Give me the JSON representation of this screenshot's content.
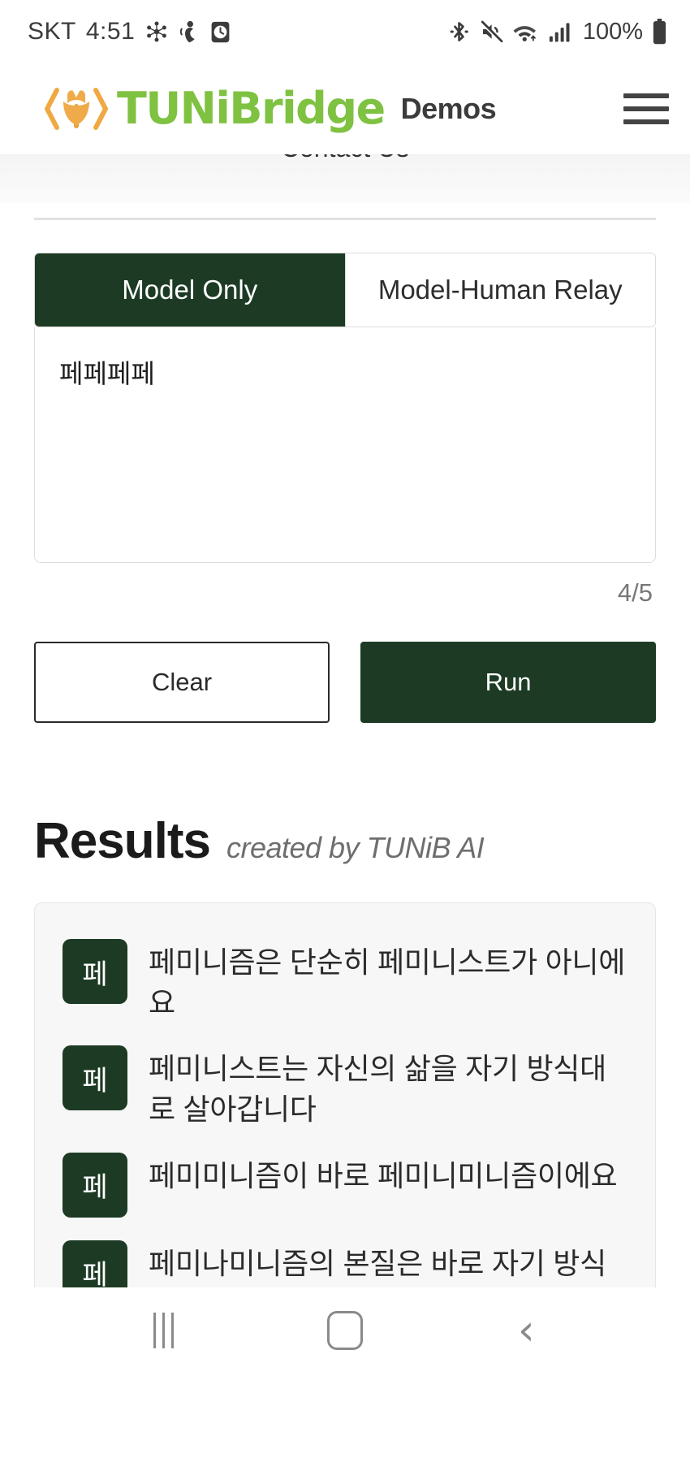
{
  "status_bar": {
    "carrier": "SKT",
    "time": "4:51",
    "battery_percent": "100%",
    "left_icons": [
      "nfc-icon",
      "vibrate-person-icon",
      "alarm-icon"
    ],
    "right_icons": [
      "bluetooth-icon",
      "mute-icon",
      "wifi-icon",
      "signal-icon",
      "battery-icon"
    ]
  },
  "header": {
    "brand_name": "TUNiBridge",
    "section_label": "Demos",
    "menu_icon": "hamburger-menu-icon",
    "brand_green": "#7fc242",
    "brand_orange": "#f0a942"
  },
  "nav": {
    "partial_item": "Contact Us"
  },
  "tabs": [
    {
      "label": "Model Only",
      "active": true
    },
    {
      "label": "Model-Human Relay",
      "active": false
    }
  ],
  "input": {
    "value": "페페페페",
    "placeholder": "",
    "counter": "4/5"
  },
  "buttons": {
    "clear": "Clear",
    "run": "Run"
  },
  "results": {
    "title": "Results",
    "subtitle": "created by TUNiB AI",
    "items": [
      {
        "badge": "페",
        "text": "페미니즘은 단순히 페미니스트가 아니에요"
      },
      {
        "badge": "페",
        "text": "페미니스트는 자신의 삶을 자기 방식대로 살아갑니다"
      },
      {
        "badge": "페",
        "text": "페미미니즘이 바로 페미니미니즘이에요"
      },
      {
        "badge": "페",
        "text": "페미나미니즘의 본질은 바로 자기 방식입니다"
      }
    ]
  },
  "android_nav": {
    "recents": "recent-apps-icon",
    "home": "home-icon",
    "back": "back-icon",
    "back_glyph": "‹"
  },
  "theme": {
    "dark_green": "#1d3b24",
    "card_bg": "#f7f7f7"
  }
}
